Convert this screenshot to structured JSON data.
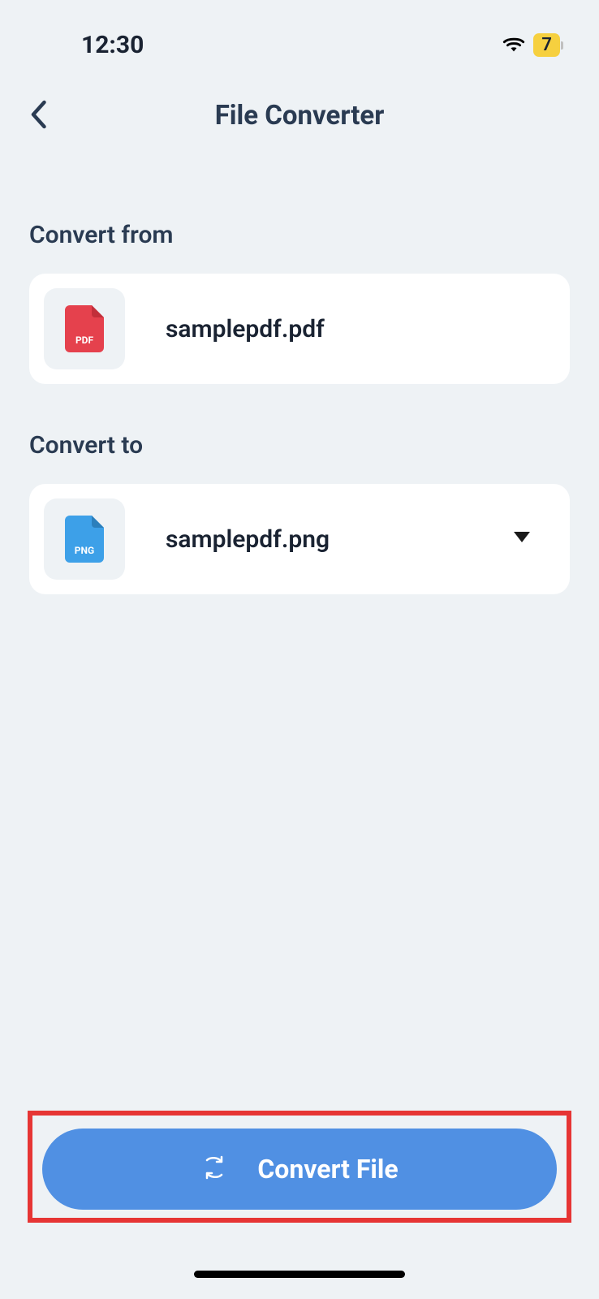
{
  "status_bar": {
    "time": "12:30",
    "battery_level": "7"
  },
  "header": {
    "title": "File Converter"
  },
  "sections": {
    "convert_from": {
      "label": "Convert from",
      "file_name": "samplepdf.pdf",
      "file_type": "PDF"
    },
    "convert_to": {
      "label": "Convert to",
      "file_name": "samplepdf.png",
      "file_type": "PNG"
    }
  },
  "action": {
    "convert_label": "Convert File"
  }
}
